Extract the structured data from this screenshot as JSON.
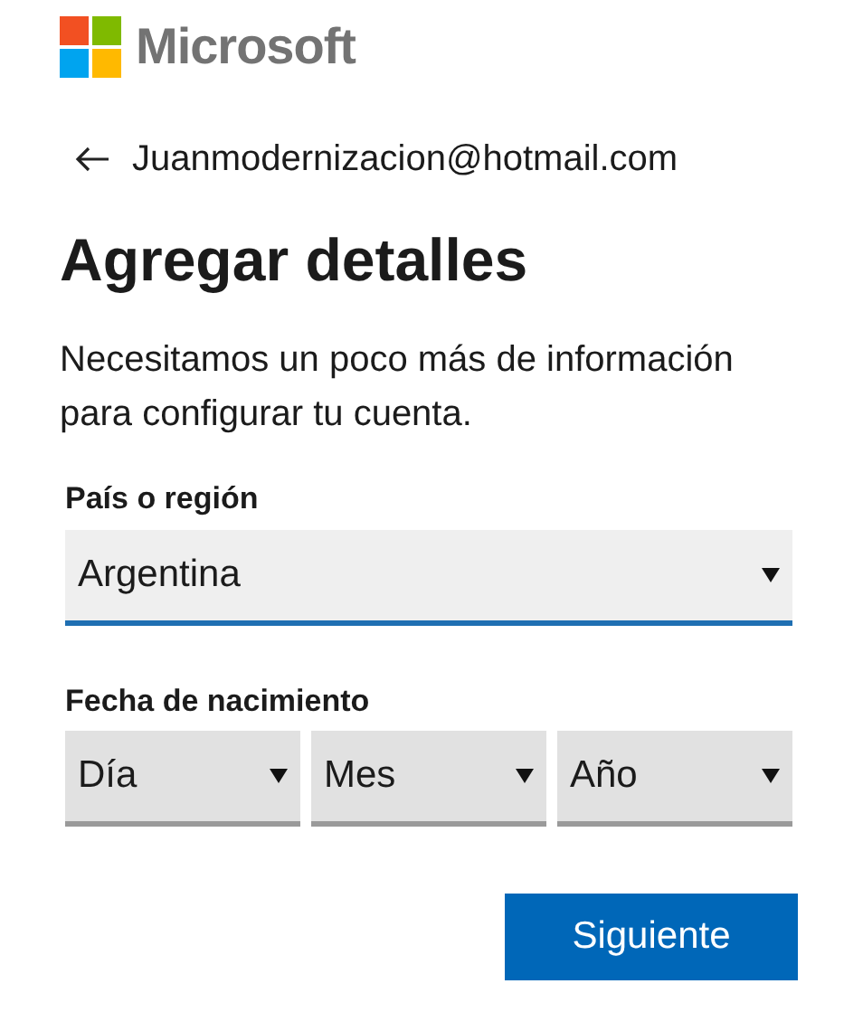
{
  "brand": {
    "name": "Microsoft"
  },
  "account": {
    "email": "Juanmodernizacion@hotmail.com"
  },
  "title": "Agregar detalles",
  "description": "Necesitamos un poco más de información para configurar tu cuenta.",
  "country": {
    "label": "País o región",
    "value": "Argentina",
    "focused": true
  },
  "birthdate": {
    "label": "Fecha de nacimiento",
    "fields": [
      {
        "value": "Día",
        "focused": false
      },
      {
        "value": "Mes",
        "focused": false
      },
      {
        "value": "Año",
        "focused": false
      }
    ]
  },
  "next_button": "Siguiente"
}
